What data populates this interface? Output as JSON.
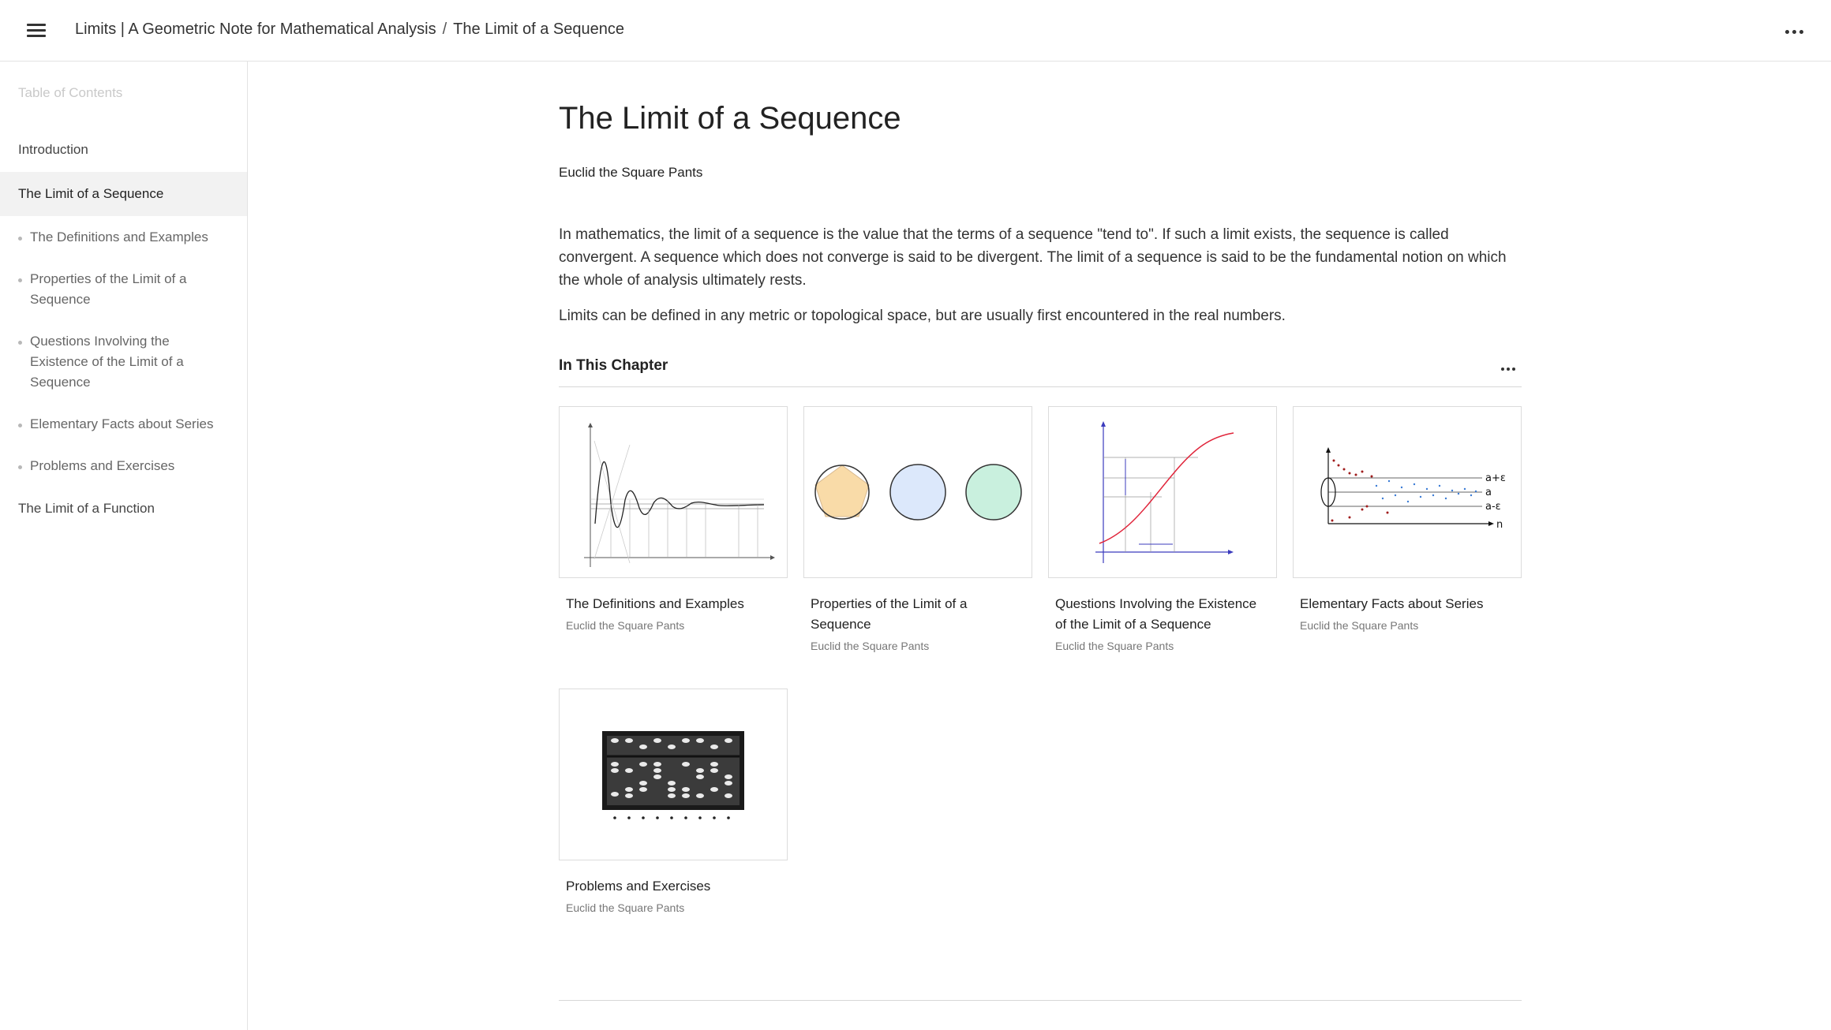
{
  "header": {
    "book_title": "Limits | A Geometric Note for Mathematical Analysis",
    "separator": "/",
    "page": "The Limit of a Sequence"
  },
  "sidebar": {
    "heading": "Table of Contents",
    "items": [
      {
        "label": "Introduction"
      },
      {
        "label": "The Limit of a Sequence"
      },
      {
        "label": "The Definitions and Examples"
      },
      {
        "label": "Properties of the Limit of a Sequence"
      },
      {
        "label": "Questions Involving the Existence of the Limit of a Sequence"
      },
      {
        "label": "Elementary Facts about Series"
      },
      {
        "label": "Problems and Exercises"
      },
      {
        "label": "The Limit of a Function"
      }
    ]
  },
  "main": {
    "title": "The Limit of a Sequence",
    "author": "Euclid the Square Pants",
    "paragraphs": [
      "In mathematics, the limit of a sequence is the value that the terms of a sequence \"tend to\". If such a limit exists, the sequence is called convergent. A sequence which does not converge is said to be divergent. The limit of a sequence is said to be the fundamental notion on which the whole of analysis ultimately rests.",
      "Limits can be defined in any metric or topological space, but are usually first encountered in the real numbers."
    ],
    "chapter_heading": "In This Chapter",
    "cards": [
      {
        "title": "The Definitions and Examples",
        "author": "Euclid the Square Pants",
        "icon": "damped-oscillation-graph"
      },
      {
        "title": "Properties of the Limit of a Sequence",
        "author": "Euclid the Square Pants",
        "icon": "polygons-circles"
      },
      {
        "title": "Questions Involving the Existence of the Limit of a Sequence",
        "author": "Euclid the Square Pants",
        "icon": "epsilon-delta-graph"
      },
      {
        "title": "Elementary Facts about Series",
        "author": "Euclid the Square Pants",
        "icon": "sequence-convergence-band"
      },
      {
        "title": "Problems and Exercises",
        "author": "Euclid the Square Pants",
        "icon": "abacus"
      }
    ],
    "figure_labels": {
      "band_upper": "a+ε",
      "band_mid": "a",
      "band_lower": "a-ε",
      "band_axis": "n"
    }
  },
  "colors": {
    "border": "#e3e3e3",
    "active_bg": "#f2f2f2",
    "muted": "#c9c9c9",
    "pentagon_fill": "#f9dba8",
    "hexagon_fill": "#dce8fb",
    "circle_fill": "#c9f0de",
    "curve_red": "#e0243a"
  }
}
